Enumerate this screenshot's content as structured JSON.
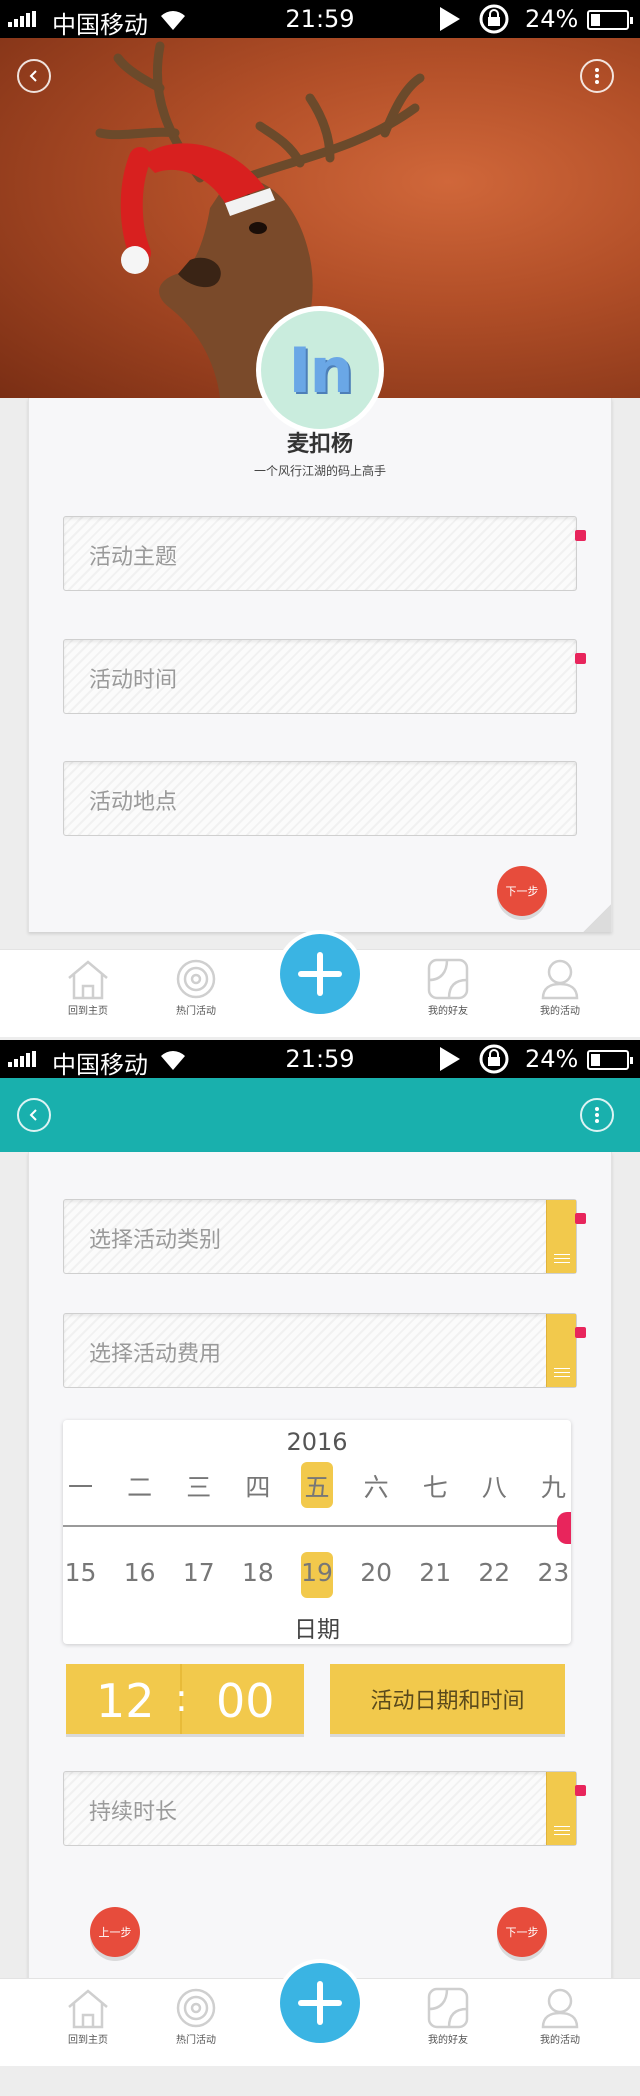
{
  "status_bar": {
    "carrier": "中国移动",
    "time": "21:59",
    "battery": "24%",
    "battery_level": 0.24
  },
  "screen1": {
    "profile": {
      "avatar_text": "In",
      "name": "麦扣杨",
      "tagline": "一个风行江湖的码上高手"
    },
    "fields": [
      {
        "placeholder": "活动主题",
        "required": true
      },
      {
        "placeholder": "活动时间",
        "required": true
      },
      {
        "placeholder": "活动地点",
        "required": false
      }
    ],
    "next_button": "下一步"
  },
  "screen2": {
    "fields": [
      {
        "placeholder": "选择活动类别",
        "required": true
      },
      {
        "placeholder": "选择活动费用",
        "required": true
      }
    ],
    "date_picker": {
      "year": "2016",
      "weekdays": [
        "一",
        "二",
        "三",
        "四",
        "五",
        "六",
        "七",
        "八",
        "九"
      ],
      "days": [
        "15",
        "16",
        "17",
        "18",
        "19",
        "20",
        "21",
        "22",
        "23"
      ],
      "selected_index": 4,
      "label": "日期"
    },
    "time": {
      "hour": "12",
      "minute": "00"
    },
    "datetime_button": "活动日期和时间",
    "duration_field": {
      "placeholder": "持续时长",
      "required": true
    },
    "prev_button": "上一步",
    "next_button": "下一步"
  },
  "tab_bar": {
    "items": [
      {
        "label": "回到主页",
        "icon": "home-icon"
      },
      {
        "label": "热门活动",
        "icon": "target-icon"
      },
      {
        "label": "我的好友",
        "icon": "friends-icon"
      },
      {
        "label": "我的活动",
        "icon": "person-icon"
      }
    ],
    "fab_icon": "plus-icon"
  },
  "colors": {
    "accent_blue": "#3ab4e3",
    "teal": "#19b0ad",
    "yellow": "#f2c94c",
    "red": "#e74c3c",
    "required_pink": "#e8255c"
  }
}
